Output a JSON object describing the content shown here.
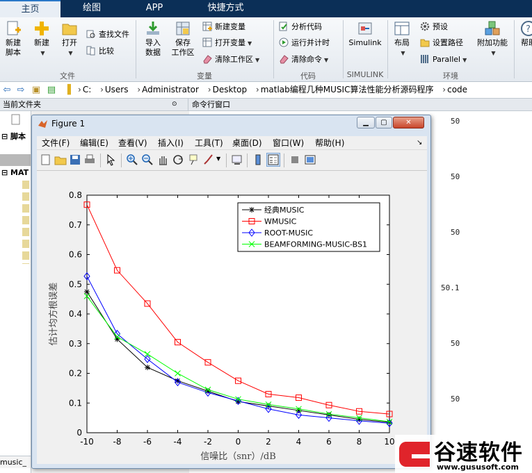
{
  "tabs": [
    {
      "label": "主页",
      "active": true
    },
    {
      "label": "绘图"
    },
    {
      "label": "APP"
    },
    {
      "label": "快捷方式"
    }
  ],
  "ribbon": {
    "groups": [
      "文件",
      "变量",
      "代码",
      "SIMULINK",
      "环境"
    ],
    "new_script": [
      "新建",
      "脚本"
    ],
    "new": "新建",
    "open": "打开",
    "find_files": "查找文件",
    "compare": "比较",
    "import_data": [
      "导入",
      "数据"
    ],
    "save_workspace": [
      "保存",
      "工作区"
    ],
    "new_variable": "新建变量",
    "open_variable": "打开变量",
    "clear_workspace": "清除工作区",
    "analyze_code": "分析代码",
    "run_and_time": "运行并计时",
    "clear_commands": "清除命令",
    "simulink": "Simulink",
    "layout": "布局",
    "preferences": "预设",
    "set_path": "设置路径",
    "parallel": "Parallel",
    "addons": "附加功能",
    "help": "帮助"
  },
  "address": {
    "crumbs": [
      "C:",
      "Users",
      "Administrator",
      "Desktop",
      "matlab编程几种MUSIC算法性能分析源码程序",
      "code"
    ]
  },
  "panes": {
    "current_folder": "当前文件夹",
    "command_window": "命令行窗口"
  },
  "leftpane": {
    "section_scripts": "脚本",
    "section_mat": "MAT",
    "status_file": "music_"
  },
  "command_output": [
    "50",
    "50",
    "50",
    "50.1",
    "50",
    "50"
  ],
  "figure": {
    "title": "Figure 1",
    "menu": [
      "文件(F)",
      "编辑(E)",
      "查看(V)",
      "插入(I)",
      "工具(T)",
      "桌面(D)",
      "窗口(W)",
      "帮助(H)"
    ]
  },
  "chart_data": {
    "type": "line",
    "xlabel": "信噪比（snr）/dB",
    "ylabel": "估计均方根误差",
    "xlim": [
      -10,
      10
    ],
    "ylim": [
      0,
      0.8
    ],
    "xticks": [
      -10,
      -8,
      -6,
      -4,
      -2,
      0,
      2,
      4,
      6,
      8,
      10
    ],
    "yticks": [
      0,
      0.1,
      0.2,
      0.3,
      0.4,
      0.5,
      0.6,
      0.7,
      0.8
    ],
    "x": [
      -10,
      -8,
      -6,
      -4,
      -2,
      0,
      2,
      4,
      6,
      8,
      10
    ],
    "legend_position": "top-right",
    "series": [
      {
        "name": "经典MUSIC",
        "color": "#000000",
        "marker": "star",
        "values": [
          0.475,
          0.315,
          0.22,
          0.175,
          0.14,
          0.105,
          0.09,
          0.075,
          0.06,
          0.045,
          0.035
        ]
      },
      {
        "name": "WMUSIC",
        "color": "#ff0000",
        "marker": "square",
        "values": [
          0.768,
          0.547,
          0.435,
          0.305,
          0.237,
          0.175,
          0.13,
          0.118,
          0.093,
          0.072,
          0.063
        ]
      },
      {
        "name": "ROOT-MUSIC",
        "color": "#0000ff",
        "marker": "diamond",
        "values": [
          0.527,
          0.333,
          0.248,
          0.17,
          0.135,
          0.107,
          0.08,
          0.06,
          0.05,
          0.04,
          0.032
        ]
      },
      {
        "name": "BEAMFORMING-MUSIC-BS1",
        "color": "#00ff00",
        "marker": "x",
        "values": [
          0.46,
          0.323,
          0.265,
          0.2,
          0.145,
          0.113,
          0.095,
          0.08,
          0.063,
          0.05,
          0.037
        ]
      }
    ]
  },
  "watermark": {
    "brand": "谷速软件",
    "url": "www.gususoft.com"
  }
}
